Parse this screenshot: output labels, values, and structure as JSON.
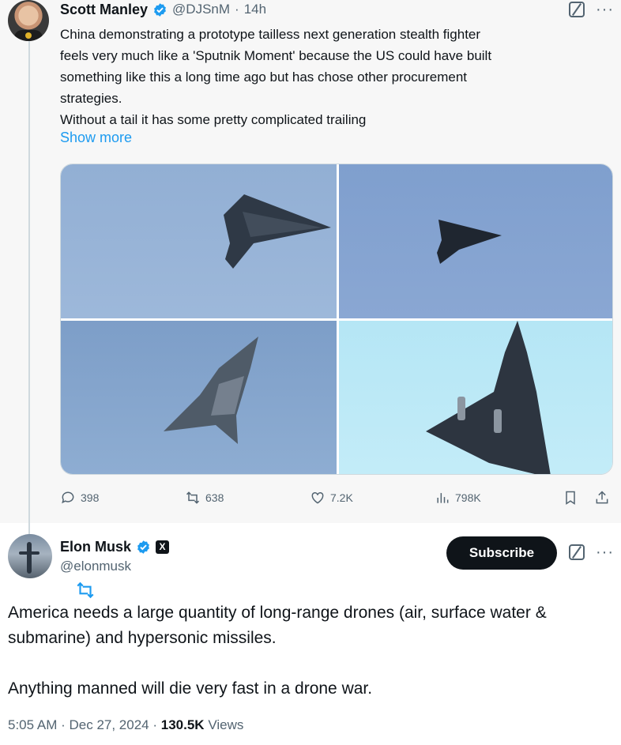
{
  "tweet1": {
    "author_name": "Scott Manley",
    "handle": "@DJSnM",
    "time": "14h",
    "text_lines": [
      "China demonstrating a prototype tailless next generation stealth fighter",
      "feels very much like a 'Sputnik Moment' because the US could have built",
      "something like this a long time ago but has chose other procurement",
      "strategies.",
      "Without a tail it has some pretty complicated trailing"
    ],
    "show_more": "Show more",
    "replies": "398",
    "reposts": "638",
    "likes": "7.2K",
    "views": "798K"
  },
  "tweet2": {
    "author_name": "Elon Musk",
    "x_badge": "X",
    "handle": "@elonmusk",
    "subscribe_label": "Subscribe",
    "paragraph1": "America needs a large quantity of long-range drones (air, surface water & submarine) and hypersonic missiles.",
    "paragraph2": "Anything manned will die very fast in a drone war.",
    "time": "5:05 AM",
    "date": "Dec 27, 2024",
    "views_count": "130.5K",
    "views_label": "Views"
  },
  "colors": {
    "accent": "#1d9bf0",
    "secondary_text": "#536471",
    "primary_text": "#0f1419",
    "verified": "#1d9bf0"
  },
  "icons": [
    "verified-badge-icon",
    "grok-icon",
    "more-icon",
    "reply-icon",
    "repost-icon",
    "like-icon",
    "views-icon",
    "bookmark-icon",
    "share-icon",
    "x-premium-icon"
  ]
}
